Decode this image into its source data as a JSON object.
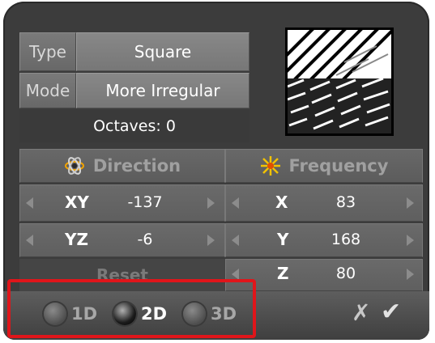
{
  "window": {
    "panel_color": "#3c3c3c",
    "highlight_color": "#e0151a"
  },
  "type_row": {
    "label": "Type",
    "value": "Square"
  },
  "mode_row": {
    "label": "Mode",
    "value": "More Irregular"
  },
  "octaves": {
    "text": "Octaves: 0"
  },
  "direction": {
    "title": "Direction",
    "icon": "atom-icon",
    "rows": [
      {
        "axis": "XY",
        "value": "-137"
      },
      {
        "axis": "YZ",
        "value": "-6"
      }
    ],
    "reset_label": "Reset"
  },
  "frequency": {
    "title": "Frequency",
    "icon": "starburst-icon",
    "rows": [
      {
        "axis": "X",
        "value": "83"
      },
      {
        "axis": "Y",
        "value": "168"
      },
      {
        "axis": "Z",
        "value": "80"
      }
    ]
  },
  "dimension": {
    "options": [
      {
        "label": "1D",
        "selected": false
      },
      {
        "label": "2D",
        "selected": true
      },
      {
        "label": "3D",
        "selected": false
      }
    ]
  },
  "actions": {
    "cancel_glyph": "✗",
    "ok_glyph": "✔"
  }
}
